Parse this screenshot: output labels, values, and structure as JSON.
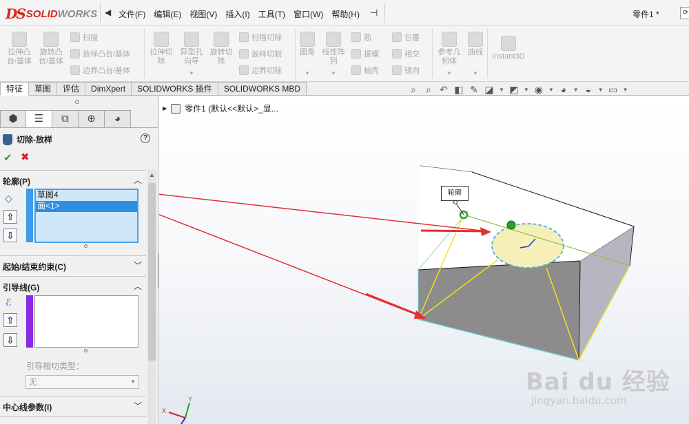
{
  "app": {
    "logo_ds": "DS",
    "logo_solid": "SOLID",
    "logo_works": "WORKS",
    "doc_title": "零件1 *"
  },
  "menu": [
    "文件(F)",
    "编辑(E)",
    "视图(V)",
    "插入(I)",
    "工具(T)",
    "窗口(W)",
    "帮助(H)"
  ],
  "ribbon": {
    "extrude_boss": "拉伸凸\n台/基体",
    "revolve_boss": "旋转凸\n台/基体",
    "sweep": "扫描",
    "loft_boss": "放样凸台/基体",
    "boundary_boss": "边界凸台/基体",
    "extrude_cut": "拉伸切\n除",
    "hole_wizard": "异型孔\n向导",
    "revolve_cut": "旋转切\n除",
    "sweep_cut": "扫描切除",
    "loft_cut": "放样切割",
    "boundary_cut": "边界切除",
    "fillet": "圆角",
    "linear_pattern": "线性阵\n列",
    "rib": "筋",
    "draft": "拔模",
    "shell": "抽壳",
    "wrap": "包覆",
    "intersect": "相交",
    "mirror": "镜向",
    "ref_geometry": "参考几\n何体",
    "curves": "曲线",
    "instant3d": "Instant3D"
  },
  "tabs": [
    "特征",
    "草图",
    "评估",
    "DimXpert",
    "SOLIDWORKS 插件",
    "SOLIDWORKS MBD"
  ],
  "panel": {
    "feature_title": "切除-放样",
    "help": "?",
    "ok": "✔",
    "cancel": "✖",
    "profile_section": "轮廓(P)",
    "profile_items": [
      "草图4",
      "面<1>"
    ],
    "start_end_section": "起始/结束约束(C)",
    "guide_section": "引导线(G)",
    "guide_tangency_label": "引导相切类型：",
    "guide_tangency_value": "无",
    "centerline_section": "中心线参数(I)"
  },
  "viewport": {
    "tree_item": "零件1  (默认<<默认>_显...",
    "callout": "轮廓",
    "watermark": "Bai du 经验",
    "watermark_url": "jingyan.baidu.com",
    "axis_x": "X",
    "axis_y": "Y"
  },
  "colors": {
    "brand_red": "#d7261e",
    "selection_blue": "#2e8ee0",
    "guide_purple": "#8a2be2",
    "arrow_red": "#e33030",
    "edge_yellow": "#f0e020"
  }
}
